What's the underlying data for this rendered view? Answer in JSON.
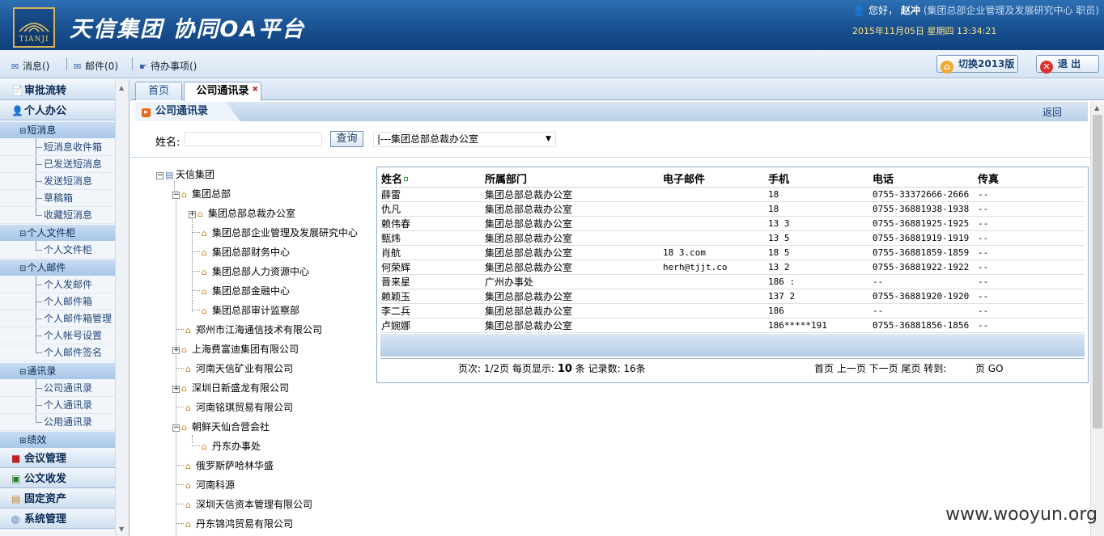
{
  "header": {
    "logo_text": "TIANJI",
    "title": "天信集团  协同OA平台",
    "greeting": "您好，",
    "user_name": "赵冲",
    "user_dept": "(集团总部企业管理及发展研究中心 职员)",
    "datetime": "2015年11月05日 星期四 13:34:21"
  },
  "toolbar": {
    "messages": "消息()",
    "mail": "邮件(0)",
    "todo": "待办事项()",
    "switch_version": "切换2013版",
    "logout": "退 出"
  },
  "sidebar": {
    "menus": [
      "审批流转",
      "个人办公",
      "会议管理",
      "公文收发",
      "固定资产",
      "系统管理"
    ],
    "groups": {
      "sms": "短消息",
      "files": "个人文件柜",
      "mail": "个人邮件",
      "contacts": "通讯录",
      "perf": "绩效"
    },
    "sms_items": [
      "短消息收件箱",
      "已发送短消息",
      "发送短消息",
      "草稿箱",
      "收藏短消息"
    ],
    "file_items": [
      "个人文件柜"
    ],
    "mail_items": [
      "个人发邮件",
      "个人邮件箱",
      "个人邮件箱管理",
      "个人帐号设置",
      "个人邮件签名"
    ],
    "contact_items": [
      "公司通讯录",
      "个人通讯录",
      "公用通讯录"
    ]
  },
  "tabs": {
    "home": "首页",
    "active": "公司通讯录"
  },
  "panel": {
    "title": "公司通讯录",
    "back": "返回"
  },
  "search": {
    "name_label": "姓名:",
    "name_value": "",
    "query_button": "查询",
    "dept_selected": "|---集团总部总裁办公室"
  },
  "tree": {
    "root": "天信集团",
    "hq": "集团总部",
    "hq_children": [
      "集团总部总裁办公室",
      "集团总部企业管理及发展研究中心",
      "集团总部财务中心",
      "集团总部人力资源中心",
      "集团总部金融中心",
      "集团总部审计监察部"
    ],
    "companies": [
      "郑州市江海通信技术有限公司",
      "上海费富迪集团有限公司",
      "河南天信矿业有限公司",
      "深圳日新盛龙有限公司",
      "河南铭琪贸易有限公司",
      "朝鲜天仙合营会社"
    ],
    "korea_child": "丹东办事处",
    "more": [
      "俄罗斯萨哈林华盛",
      "河南科源",
      "深圳天信资本管理有限公司",
      "丹东锦鸿贸易有限公司"
    ]
  },
  "table": {
    "columns": [
      "姓名",
      "所属部门",
      "电子邮件",
      "手机",
      "电话",
      "传真"
    ],
    "rows": [
      [
        "薛雷",
        "集团总部总裁办公室",
        "",
        "18",
        "0755-33372666-2666",
        "--"
      ],
      [
        "仇凡",
        "集团总部总裁办公室",
        "",
        "18",
        "0755-36881938-1938",
        "--"
      ],
      [
        "赖伟春",
        "集团总部总裁办公室",
        "",
        "13 3",
        "0755-36881925-1925",
        "--"
      ],
      [
        "甄炜",
        "集团总部总裁办公室",
        "",
        "13 5",
        "0755-36881919-1919",
        "--"
      ],
      [
        "肖航",
        "集团总部总裁办公室",
        "18 3.com",
        "18 5",
        "0755-36881859-1859",
        "--"
      ],
      [
        "何荣辉",
        "集团总部总裁办公室",
        "herh@tjjt.co",
        "13 2",
        "0755-36881922-1922",
        "--"
      ],
      [
        "晋来星",
        "广州办事处",
        "",
        "186 :",
        "--",
        "--"
      ],
      [
        "赖颖玉",
        "集团总部总裁办公室",
        "",
        "137 2",
        "0755-36881920-1920",
        "--"
      ],
      [
        "李二兵",
        "集团总部总裁办公室",
        "",
        "186",
        "--",
        "--"
      ],
      [
        "卢婉娜",
        "集团总部总裁办公室",
        "",
        "186*****191",
        "0755-36881856-1856",
        "--"
      ]
    ],
    "pager_left": "页次: 1/2页  每页显示: ",
    "page_size": "10",
    "pager_mid": " 条  记录数: 16条",
    "pager_right": "首页 上一页 下一页 尾页 转到:",
    "pager_go": "页 GO"
  },
  "watermark": "www.wooyun.org"
}
